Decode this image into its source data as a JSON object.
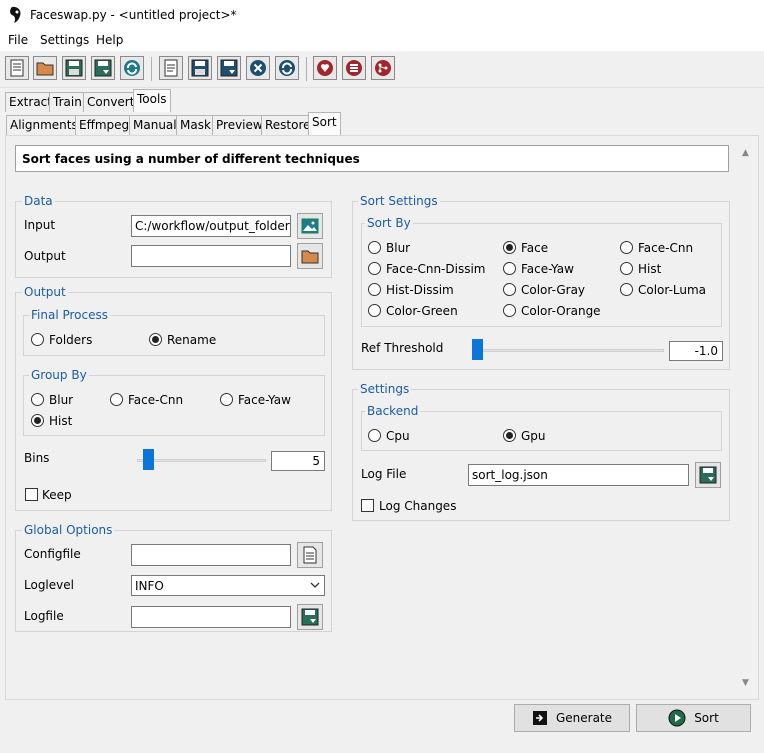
{
  "window": {
    "title": "Faceswap.py - <untitled project>*"
  },
  "menu": [
    "File",
    "Settings",
    "Help"
  ],
  "toolbar_icons": [
    "new-project-icon",
    "open-project-icon",
    "save-project-icon",
    "save-as-project-icon",
    "reload-project-icon",
    "new-task-icon",
    "save-task-icon",
    "save-task-as-icon",
    "clear-icon",
    "reload-icon",
    "donate-icon",
    "menu-icon",
    "git-icon"
  ],
  "tabs_main": [
    "Extract",
    "Train",
    "Convert",
    "Tools"
  ],
  "tabs_tools": [
    "Alignments",
    "Effmpeg",
    "Manual",
    "Mask",
    "Preview",
    "Restore",
    "Sort"
  ],
  "description": "Sort faces using a number of different techniques",
  "data_group": {
    "title": "Data",
    "input_label": "Input",
    "input_value": "C:/workflow/output_folder",
    "output_label": "Output",
    "output_value": ""
  },
  "output_group": {
    "title": "Output",
    "final_process": {
      "title": "Final Process",
      "options": [
        "Folders",
        "Rename"
      ],
      "selected": "Rename"
    },
    "group_by": {
      "title": "Group By",
      "options": [
        "Blur",
        "Face-Cnn",
        "Face-Yaw",
        "Hist"
      ],
      "selected": "Hist"
    },
    "bins_label": "Bins",
    "bins_value": "5",
    "bins_fraction": 0.05,
    "keep_label": "Keep"
  },
  "global_options": {
    "title": "Global Options",
    "configfile_label": "Configfile",
    "configfile_value": "",
    "loglevel_label": "Loglevel",
    "loglevel_value": "INFO",
    "logfile_label": "Logfile",
    "logfile_value": ""
  },
  "sort_settings": {
    "title": "Sort Settings",
    "sort_by": {
      "title": "Sort By",
      "options": [
        "Blur",
        "Face",
        "Face-Cnn",
        "Face-Cnn-Dissim",
        "Face-Yaw",
        "Hist",
        "Hist-Dissim",
        "Color-Gray",
        "Color-Luma",
        "Color-Green",
        "Color-Orange"
      ],
      "selected": "Face"
    },
    "ref_threshold_label": "Ref Threshold",
    "ref_threshold_value": "-1.0",
    "ref_threshold_fraction": 0.0
  },
  "settings": {
    "title": "Settings",
    "backend": {
      "title": "Backend",
      "options": [
        "Cpu",
        "Gpu"
      ],
      "selected": "Gpu"
    },
    "log_file_label": "Log File",
    "log_file_value": "sort_log.json",
    "log_changes_label": "Log Changes"
  },
  "actions": {
    "generate_label": "Generate",
    "sort_label": "Sort"
  },
  "colors": {
    "accent": "#0a76d8",
    "group_title": "#1a5ca8"
  }
}
